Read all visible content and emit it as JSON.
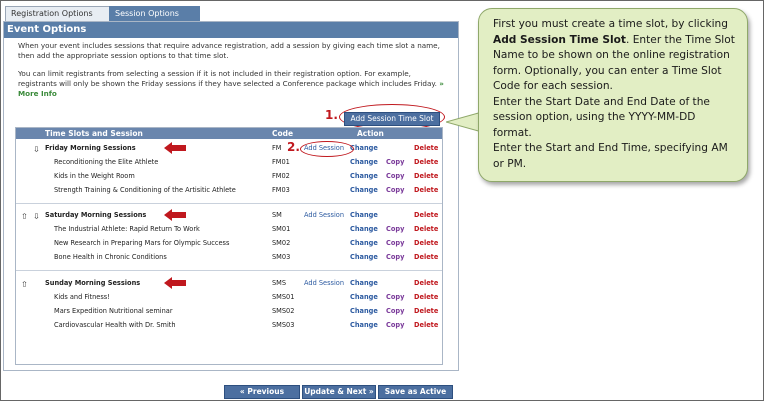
{
  "tabs": {
    "registration": "Registration Options",
    "session": "Session Options"
  },
  "panel_title": "Event Options",
  "intro": {
    "para1": "When your event includes sessions that require advance registration, add a session by giving each time slot a name, then add the appropriate session options to that time slot.",
    "para2": "You can limit registrants from selecting a session if it is not included in their registration option. For example, registrants will only be shown the Friday sessions if they have selected a Conference package which includes Friday.",
    "more_info": "» More Info"
  },
  "add_slot_button": "Add Session Time Slot",
  "step1": "1.",
  "step2": "2.",
  "table": {
    "headers": {
      "name": "Time Slots and Session",
      "code": "Code",
      "action": "Action"
    },
    "action_labels": {
      "add_session": "Add Session",
      "change": "Change",
      "copy": "Copy",
      "delete": "Delete"
    },
    "groups": [
      {
        "name": "Friday Morning Sessions",
        "code": "FM",
        "sessions": [
          {
            "name": "Reconditioning the Elite Athlete",
            "code": "FM01"
          },
          {
            "name": "Kids in the Weight Room",
            "code": "FM02"
          },
          {
            "name": "Strength Training & Conditioning of the Artisitic Athlete",
            "code": "FM03"
          }
        ]
      },
      {
        "name": "Saturday Morning Sessions",
        "code": "SM",
        "sessions": [
          {
            "name": "The Industrial Athlete: Rapid Return To Work",
            "code": "SM01"
          },
          {
            "name": "New Research in Preparing Mars for Olympic Success",
            "code": "SM02"
          },
          {
            "name": "Bone Health in Chronic Conditions",
            "code": "SM03"
          }
        ]
      },
      {
        "name": "Sunday Morning Sessions",
        "code": "SMS",
        "sessions": [
          {
            "name": "Kids and Fitness!",
            "code": "SMS01"
          },
          {
            "name": "Mars Expedition Nutritional seminar",
            "code": "SMS02"
          },
          {
            "name": "Cardiovascular Health with Dr. Smith",
            "code": "SMS03"
          }
        ]
      }
    ]
  },
  "callout": {
    "line1_pre": "First you must create a time slot, by clicking ",
    "line1_bold": "Add Session Time Slot",
    "line1_post": ". Enter the Time Slot Name to be shown on the online registration form. Optionally, you can enter a Time Slot Code for each session.",
    "line2": "Enter the Start Date and End Date of the session option, using the YYYY-MM-DD format.",
    "line3": "Enter the Start and End Time, specifying AM or PM."
  },
  "nav": {
    "previous": "« Previous",
    "update_next": "Update & Next »",
    "save_active": "Save as Active"
  },
  "colors": {
    "accent": "#5a7ea8",
    "annotation_red": "#c0181e",
    "callout_bg": "#e2eec4"
  }
}
